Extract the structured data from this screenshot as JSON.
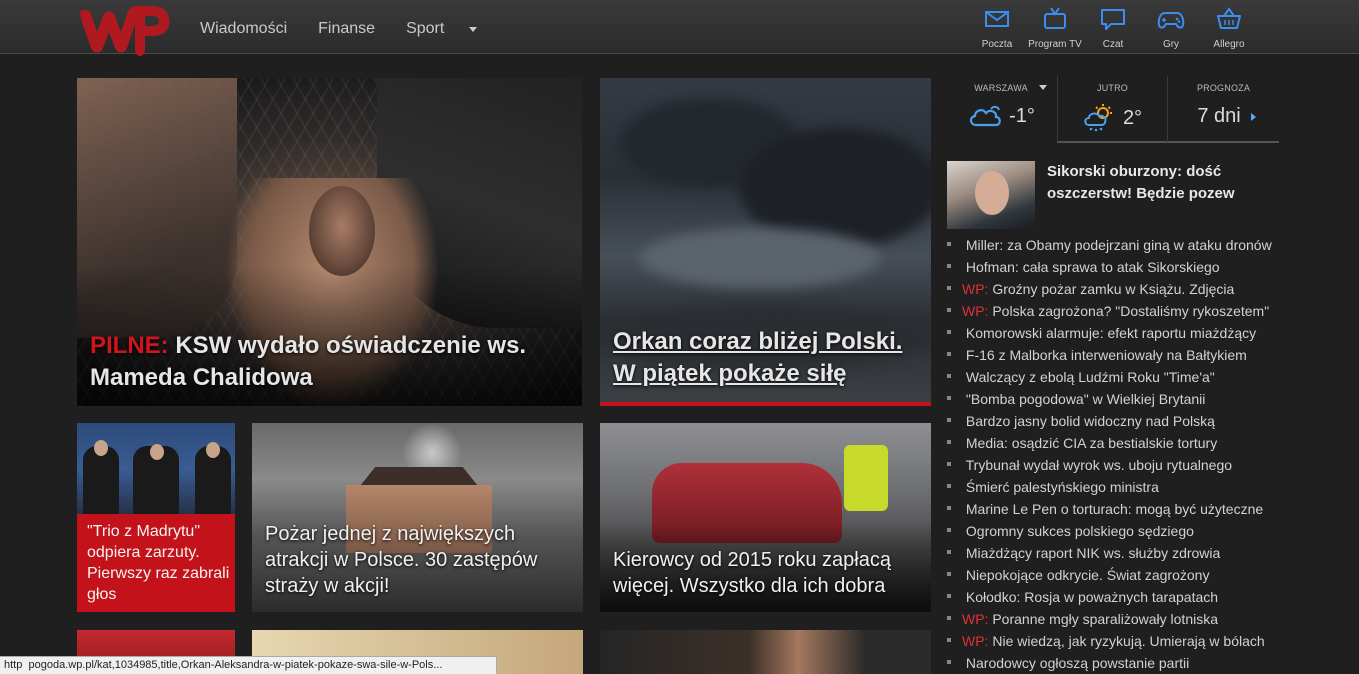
{
  "header": {
    "logo_text": "WP",
    "nav": [
      "Wiadomości",
      "Finanse",
      "Sport"
    ],
    "services": [
      {
        "label": "Poczta",
        "icon": "mail-icon"
      },
      {
        "label": "Program TV",
        "icon": "tv-icon"
      },
      {
        "label": "Czat",
        "icon": "chat-icon"
      },
      {
        "label": "Gry",
        "icon": "gamepad-icon"
      },
      {
        "label": "Allegro",
        "icon": "basket-icon"
      }
    ],
    "accent_color": "#3b8df0"
  },
  "hero": {
    "ksw": {
      "prefix": "PILNE:",
      "text": "KSW wydało oświadczenie ws. Mameda Chalidowa"
    },
    "orkan": {
      "text": "Orkan coraz bliżej Polski. W piątek pokaże siłę"
    }
  },
  "tiles": {
    "trio": "\"Trio z Madrytu\" odpiera zarzuty. Pierwszy raz zabrali głos",
    "pozar": "Pożar jednej z największych atrakcji w Polsce. 30 zastępów straży w akcji!",
    "kierowcy": "Kierowcy od 2015 roku zapłacą więcej. Wszystko dla ich dobra"
  },
  "weather": {
    "city": "WARSZAWA",
    "city_temp": "-1°",
    "tomorrow_label": "JUTRO",
    "tomorrow_temp": "2°",
    "forecast_label": "PROGNOZA",
    "forecast_value": "7 dni"
  },
  "feature": {
    "title": "Sikorski oburzony: dość oszczerstw! Będzie pozew"
  },
  "news": [
    {
      "wp": "",
      "text": "Miller: za Obamy podejrzani giną w ataku dronów"
    },
    {
      "wp": "",
      "text": "Hofman: cała sprawa to atak Sikorskiego"
    },
    {
      "wp": "WP:",
      "text": "Groźny pożar zamku w Książu. Zdjęcia"
    },
    {
      "wp": "WP:",
      "text": "Polska zagrożona? \"Dostaliśmy rykoszetem\""
    },
    {
      "wp": "",
      "text": "Komorowski alarmuje: efekt raportu miażdżący"
    },
    {
      "wp": "",
      "text": "F-16 z Malborka interweniowały na Bałtykiem"
    },
    {
      "wp": "",
      "text": "Walczący z ebolą Ludźmi Roku \"Time'a\""
    },
    {
      "wp": "",
      "text": "\"Bomba pogodowa\" w Wielkiej Brytanii"
    },
    {
      "wp": "",
      "text": "Bardzo jasny bolid widoczny nad Polską"
    },
    {
      "wp": "",
      "text": "Media: osądzić CIA za bestialskie tortury"
    },
    {
      "wp": "",
      "text": "Trybunał wydał wyrok ws. uboju rytualnego"
    },
    {
      "wp": "",
      "text": "Śmierć palestyńskiego ministra"
    },
    {
      "wp": "",
      "text": "Marine Le Pen o torturach: mogą być użyteczne"
    },
    {
      "wp": "",
      "text": "Ogromny sukces polskiego sędziego"
    },
    {
      "wp": "",
      "text": "Miażdżący raport NIK ws. służby zdrowia"
    },
    {
      "wp": "",
      "text": "Niepokojące odkrycie. Świat zagrożony"
    },
    {
      "wp": "",
      "text": "Kołodko: Rosja w poważnych tarapatach"
    },
    {
      "wp": "WP:",
      "text": "Poranne mgły sparaliżowały lotniska"
    },
    {
      "wp": "WP:",
      "text": "Nie wiedzą, jak ryzykują. Umierają w bólach"
    },
    {
      "wp": "",
      "text": "Narodowcy ogłoszą powstanie partii"
    }
  ],
  "statusbar": {
    "prefix": "http",
    "domain": "pogoda.wp.pl",
    "path": "/kat,1034985,title,Orkan-Aleksandra-w-piatek-pokaze-swa-sile-w-Pols..."
  }
}
